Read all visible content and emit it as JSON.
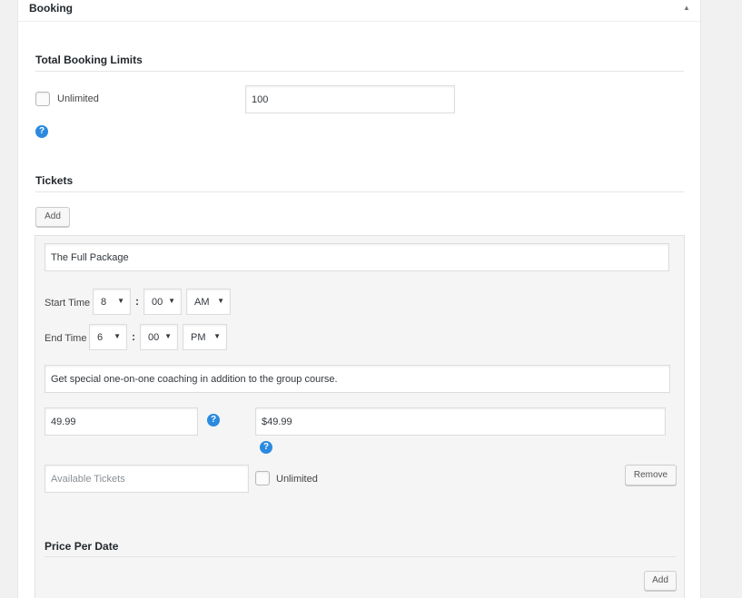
{
  "panel": {
    "title": "Booking",
    "toggle_glyph": "▲"
  },
  "limits": {
    "section_title": "Total Booking Limits",
    "unlimited_label": "Unlimited",
    "unlimited_checked": false,
    "limit_value": "100"
  },
  "help_icon_glyph": "?",
  "tickets": {
    "section_title": "Tickets",
    "add_label": "Add",
    "ticket": {
      "name": "The Full Package",
      "start_time": {
        "label": "Start Time",
        "hour": "8",
        "minute": "00",
        "ampm": "AM"
      },
      "end_time": {
        "label": "End Time",
        "hour": "6",
        "minute": "00",
        "ampm": "PM"
      },
      "separator": ":",
      "caret": "▼",
      "description": "Get special one-on-one coaching in addition to the group course.",
      "price": "49.99",
      "price_label": "$49.99",
      "available_placeholder": "Available Tickets",
      "available_value": "",
      "unlimited_label": "Unlimited",
      "unlimited_checked": false,
      "remove_label": "Remove"
    },
    "price_per_date": {
      "title": "Price Per Date",
      "add_label": "Add"
    }
  }
}
